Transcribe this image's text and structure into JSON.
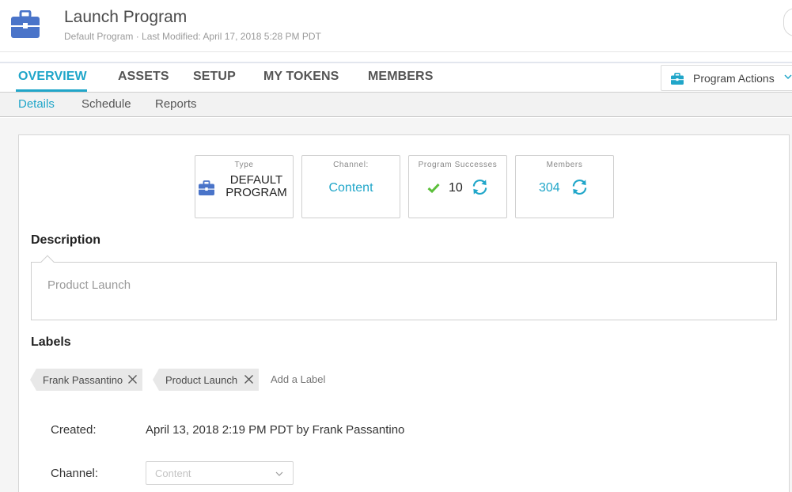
{
  "header": {
    "title": "Launch Program",
    "subtitle": "Default Program · Last Modified: April 17, 2018 5:28 PM PDT",
    "icon": "briefcase-icon"
  },
  "tabs": [
    {
      "label": "OVERVIEW",
      "active": true
    },
    {
      "label": "ASSETS"
    },
    {
      "label": "SETUP"
    },
    {
      "label": "MY TOKENS"
    },
    {
      "label": "MEMBERS"
    }
  ],
  "program_actions": {
    "label": "Program Actions",
    "icon": "briefcase-icon"
  },
  "subtabs": [
    {
      "label": "Details",
      "active": true
    },
    {
      "label": "Schedule"
    },
    {
      "label": "Reports"
    }
  ],
  "stats": {
    "type": {
      "label": "Type",
      "value_line1": "DEFAULT",
      "value_line2": "PROGRAM"
    },
    "channel": {
      "label": "Channel:",
      "value": "Content"
    },
    "successes": {
      "label": "Program Successes",
      "value": "10"
    },
    "members": {
      "label": "Members",
      "value": "304"
    }
  },
  "description": {
    "title": "Description",
    "text": "Product Launch"
  },
  "labels": {
    "title": "Labels",
    "items": [
      "Frank Passantino",
      "Product Launch"
    ],
    "add_placeholder": "Add a Label"
  },
  "details": {
    "created_label": "Created:",
    "created_value": "April 13, 2018 2:19 PM PDT by Frank Passantino",
    "channel_label": "Channel:",
    "channel_select": "Content"
  },
  "colors": {
    "accent": "#20a6c9",
    "icon_blue": "#4a74c9",
    "check_green": "#5bbf3a"
  }
}
